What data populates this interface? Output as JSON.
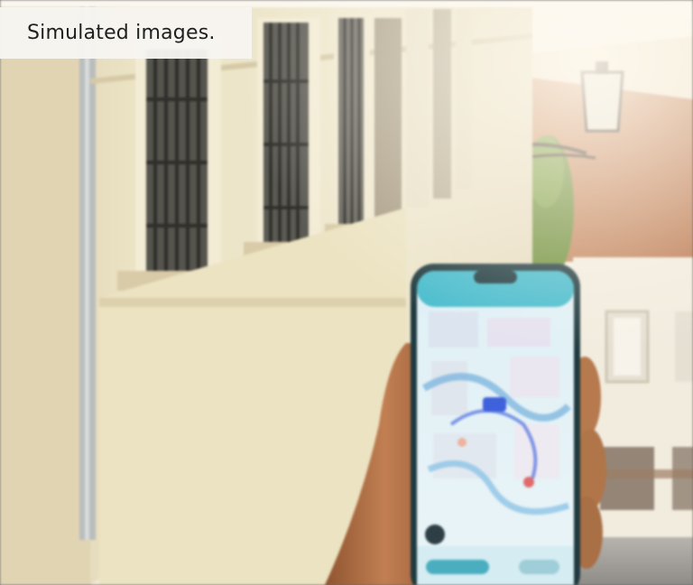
{
  "caption": {
    "text": "Simulated images."
  },
  "scene": {
    "subject": "hand-holding-phone-with-map-app",
    "colors": {
      "wall": "#ece3c4",
      "wall_shadow": "#cfc3a0",
      "roof": "#c78b63",
      "sky": "#f6efe2",
      "phone_screen": "#e8f3f7",
      "phone_accent": "#47b7c8",
      "map_route": "#4e6fe0",
      "skin": "#b5784f"
    }
  }
}
